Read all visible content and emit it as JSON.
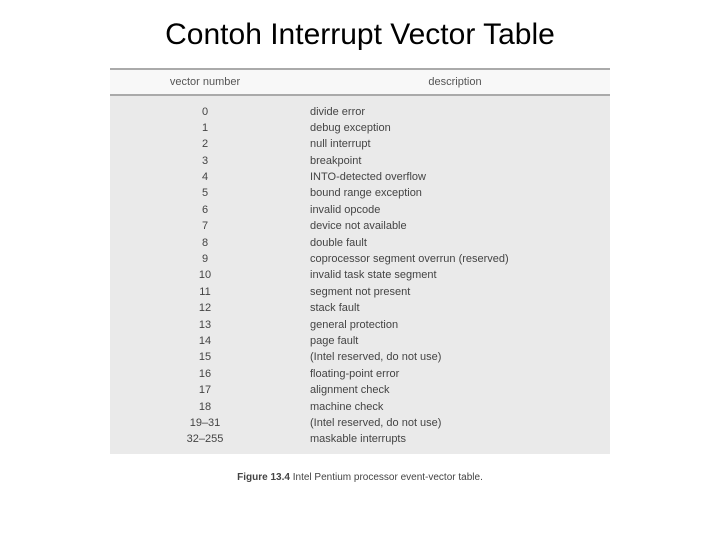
{
  "title": "Contoh Interrupt Vector Table",
  "headers": {
    "vector": "vector number",
    "description": "description"
  },
  "rows": [
    {
      "vector": "0",
      "desc": "divide error"
    },
    {
      "vector": "1",
      "desc": "debug exception"
    },
    {
      "vector": "2",
      "desc": "null interrupt"
    },
    {
      "vector": "3",
      "desc": "breakpoint"
    },
    {
      "vector": "4",
      "desc": "INTO-detected overflow"
    },
    {
      "vector": "5",
      "desc": "bound range exception"
    },
    {
      "vector": "6",
      "desc": "invalid opcode"
    },
    {
      "vector": "7",
      "desc": "device not available"
    },
    {
      "vector": "8",
      "desc": "double fault"
    },
    {
      "vector": "9",
      "desc": "coprocessor segment overrun (reserved)"
    },
    {
      "vector": "10",
      "desc": "invalid task state segment"
    },
    {
      "vector": "11",
      "desc": "segment not present"
    },
    {
      "vector": "12",
      "desc": "stack fault"
    },
    {
      "vector": "13",
      "desc": "general protection"
    },
    {
      "vector": "14",
      "desc": "page fault"
    },
    {
      "vector": "15",
      "desc": "(Intel reserved, do not use)"
    },
    {
      "vector": "16",
      "desc": "floating-point error"
    },
    {
      "vector": "17",
      "desc": "alignment check"
    },
    {
      "vector": "18",
      "desc": "machine check"
    },
    {
      "vector": "19–31",
      "desc": "(Intel reserved, do not use)"
    },
    {
      "vector": "32–255",
      "desc": "maskable interrupts"
    }
  ],
  "caption": {
    "label": "Figure 13.4",
    "text": "Intel Pentium processor event-vector table."
  }
}
